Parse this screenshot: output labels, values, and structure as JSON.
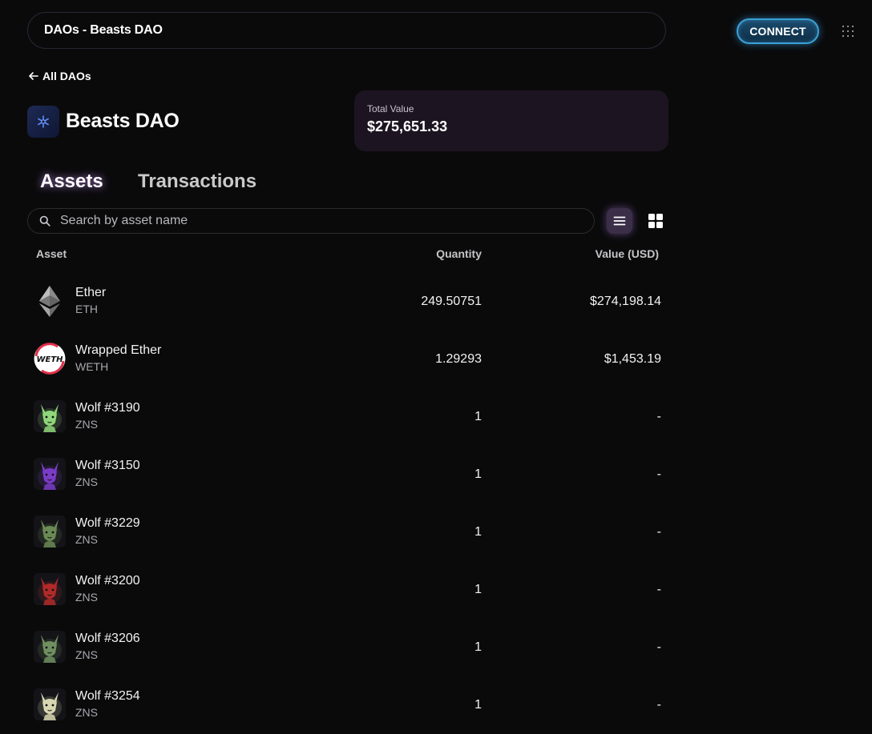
{
  "header": {
    "title": "DAOs - Beasts DAO",
    "connect_label": "CONNECT"
  },
  "nav": {
    "back_label": "All DAOs"
  },
  "dao": {
    "name": "Beasts DAO",
    "total_value_label": "Total Value",
    "total_value": "$275,651.33"
  },
  "tabs": [
    {
      "label": "Assets",
      "active": true
    },
    {
      "label": "Transactions",
      "active": false
    }
  ],
  "search": {
    "placeholder": "Search by asset name",
    "value": ""
  },
  "table": {
    "columns": {
      "asset": "Asset",
      "quantity": "Quantity",
      "value": "Value (USD)"
    },
    "rows": [
      {
        "name": "Ether",
        "symbol": "ETH",
        "quantity": "249.50751",
        "value": "$274,198.14",
        "icon": "eth-icon"
      },
      {
        "name": "Wrapped Ether",
        "symbol": "WETH",
        "quantity": "1.29293",
        "value": "$1,453.19",
        "icon": "weth-icon",
        "icon_text": "WETH"
      },
      {
        "name": "Wolf #3190",
        "symbol": "ZNS",
        "quantity": "1",
        "value": "-",
        "icon": "wolf-nft-thumbnail",
        "color": "#8fd67a"
      },
      {
        "name": "Wolf #3150",
        "symbol": "ZNS",
        "quantity": "1",
        "value": "-",
        "icon": "wolf-nft-thumbnail",
        "color": "#7a3cc8"
      },
      {
        "name": "Wolf #3229",
        "symbol": "ZNS",
        "quantity": "1",
        "value": "-",
        "icon": "wolf-nft-thumbnail",
        "color": "#6a8a55"
      },
      {
        "name": "Wolf #3200",
        "symbol": "ZNS",
        "quantity": "1",
        "value": "-",
        "icon": "wolf-nft-thumbnail",
        "color": "#b02a2a"
      },
      {
        "name": "Wolf #3206",
        "symbol": "ZNS",
        "quantity": "1",
        "value": "-",
        "icon": "wolf-nft-thumbnail",
        "color": "#6f8f60"
      },
      {
        "name": "Wolf #3254",
        "symbol": "ZNS",
        "quantity": "1",
        "value": "-",
        "icon": "wolf-nft-thumbnail",
        "color": "#d8d6b0"
      }
    ]
  }
}
